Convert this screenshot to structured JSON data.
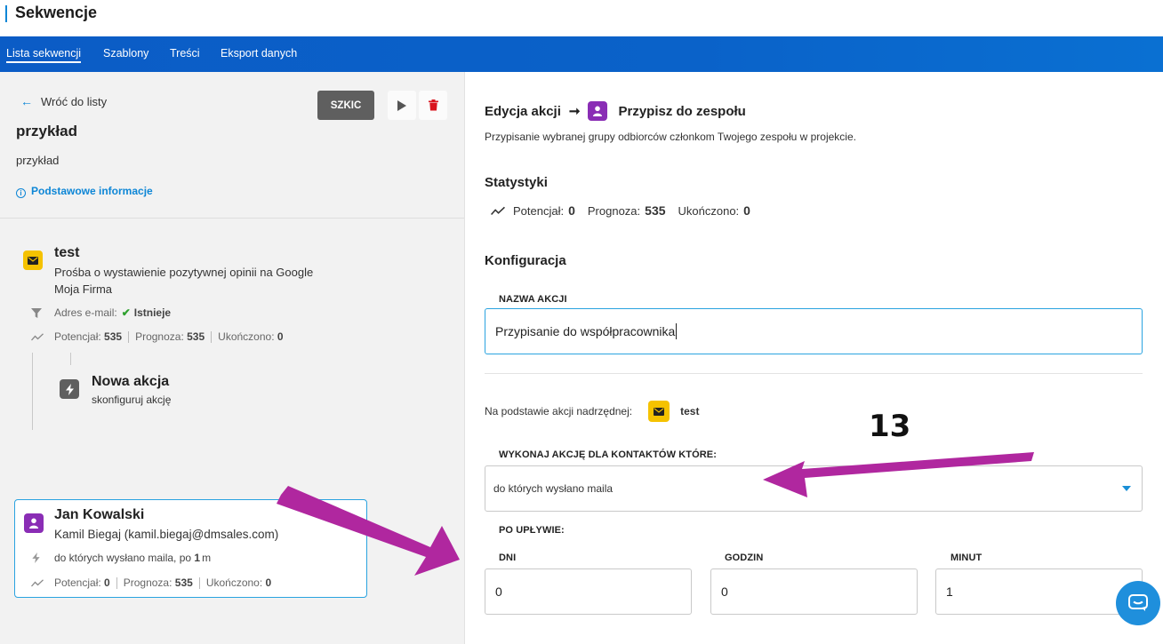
{
  "header": {
    "title": "Sekwencje"
  },
  "nav": {
    "tabs": [
      {
        "label": "Lista sekwencji",
        "active": true
      },
      {
        "label": "Szablony",
        "active": false
      },
      {
        "label": "Treści",
        "active": false
      },
      {
        "label": "Eksport danych",
        "active": false
      }
    ]
  },
  "left": {
    "back_label": "Wróć do listy",
    "status_badge": "SZKIC",
    "sequence_name": "przykład",
    "sequence_desc": "przykład",
    "basic_info_link": "Podstawowe informacje",
    "nodes": [
      {
        "title": "test",
        "line1": "Prośba o wystawienie pozytywnej opinii na Google",
        "line2": "Moja Firma",
        "condition_label": "Adres e-mail:",
        "condition_value": "Istnieje",
        "stats": {
          "potencjal_label": "Potencjał:",
          "potencjal": "535",
          "prognoza_label": "Prognoza:",
          "prognoza": "535",
          "ukonczono_label": "Ukończono:",
          "ukonczono": "0"
        }
      },
      {
        "title": "Nowa akcja",
        "line1": "skonfiguruj akcję"
      },
      {
        "title": "Jan Kowalski",
        "line1": "Kamil Biegaj (kamil.biegaj@dmsales.com)",
        "condition_text": "do których wysłano maila, po",
        "condition_value": "1",
        "condition_unit": "m",
        "stats": {
          "potencjal_label": "Potencjał:",
          "potencjal": "0",
          "prognoza_label": "Prognoza:",
          "prognoza": "535",
          "ukonczono_label": "Ukończono:",
          "ukonczono": "0"
        }
      }
    ]
  },
  "right": {
    "edit_label": "Edycja akcji",
    "arrow": "➞",
    "action_name": "Przypisz do zespołu",
    "action_desc": "Przypisanie wybranej grupy odbiorców członkom Twojego zespołu w projekcie.",
    "stats_title": "Statystyki",
    "stats": {
      "potencjal_label": "Potencjał:",
      "potencjal": "0",
      "prognoza_label": "Prognoza:",
      "prognoza": "535",
      "ukonczono_label": "Ukończono:",
      "ukonczono": "0"
    },
    "config_title": "Konfiguracja",
    "action_name_label": "NAZWA AKCJI",
    "action_name_value": "Przypisanie do współpracownika",
    "parent_label": "Na podstawie akcji nadrzędnej:",
    "parent_value": "test",
    "contacts_label": "WYKONAJ AKCJĘ DLA KONTAKTÓW KTÓRE:",
    "contacts_value": "do których wysłano maila",
    "after_label": "PO UPŁYWIE:",
    "days_label": "DNI",
    "days_value": "0",
    "hours_label": "GODZIN",
    "hours_value": "0",
    "minutes_label": "MINUT",
    "minutes_value": "1"
  },
  "annotation": {
    "number": "13",
    "color": "#b0279f"
  },
  "colors": {
    "accent": "#0d86d6",
    "nav": "#0b5cc6",
    "email_icon": "#f5c200",
    "person_icon": "#8a2db5",
    "delete": "#d9141e",
    "check": "#2fa12f"
  }
}
